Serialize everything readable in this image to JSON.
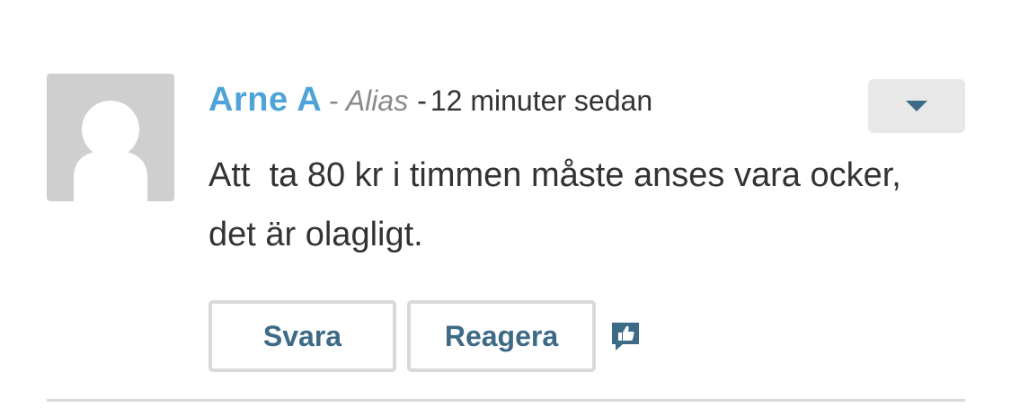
{
  "comment": {
    "author": "Arne A",
    "separator": "-",
    "alias": "Alias",
    "time": "12 minuter sedan",
    "text": "Att  ta 80 kr i timmen måste anses vara ocker, det är olagligt.",
    "avatar_icon": "default-user-avatar-icon",
    "menu_icon": "caret-down-icon"
  },
  "actions": {
    "reply_label": "Svara",
    "react_label": "Reagera",
    "react_icon": "thumbs-up-speech-bubble-icon"
  },
  "colors": {
    "author": "#4ea3d9",
    "button_text": "#3d6a86",
    "avatar_bg": "#cfcfcf",
    "menu_bg": "#e8e8e8",
    "border": "#d9d9d9"
  }
}
